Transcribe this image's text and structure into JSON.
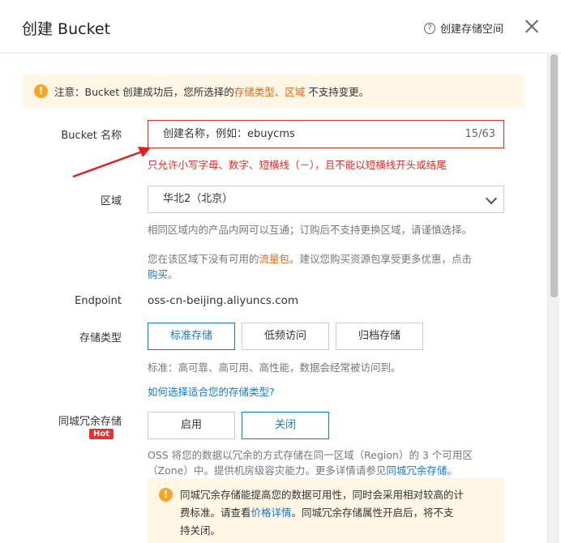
{
  "dialog": {
    "title": "创建 Bucket",
    "help_label": "创建存储空间",
    "help_icon": "?"
  },
  "notice": {
    "prefix": "注意：Bucket 创建成功后，您所选择的",
    "link1": "存储类型",
    "sep": "、",
    "link2": "区域",
    "suffix": "不支持变更。",
    "icon": "!"
  },
  "bucket_name": {
    "label": "Bucket 名称",
    "value": "创建名称，例如：ebuycms",
    "counter": "15/63",
    "error": "只允许小写字母、数字、短横线（－），且不能以短横线开头或结尾"
  },
  "region": {
    "label": "区域",
    "selected": "华北2（北京）",
    "hint1": "相同区域内的产品内网可以互通；订购后不支持更换区域，请谨慎选择。",
    "hint2_prefix": "您在该区域下没有可用的",
    "hint2_link": "流量包",
    "hint2_suffix": "。建议您购买资源包享受更多优惠，点击",
    "hint2_buy": "购买",
    "hint2_end": "。"
  },
  "endpoint": {
    "label": "Endpoint",
    "value": "oss-cn-beijing.aliyuncs.com"
  },
  "storage_class": {
    "label": "存储类型",
    "options": [
      "标准存储",
      "低频访问",
      "归档存储"
    ],
    "selected_index": 0,
    "hint": "标准：高可靠、高可用、高性能，数据会经常被访问到。",
    "link": "如何选择适合您的存储类型?"
  },
  "redundancy": {
    "label": "同城冗余存储",
    "hot_badge": "Hot",
    "options": [
      "启用",
      "关闭"
    ],
    "selected_index": 1,
    "desc_line1": "OSS 将您的数据以冗余的方式存储在同一区域（Region）的 3 个可用区",
    "desc_line2_prefix": "（Zone）中。提供机房级容灾能力。更多详情请参见",
    "desc_link": "同城冗余存储",
    "desc_end": "。",
    "tip_line1": "同城冗余存储能提高您的数据可用性，同时会采用相对较高的计",
    "tip_line2_prefix": "费标准。请查看",
    "tip_link": "价格详情",
    "tip_line2_suffix": "。同城冗余存储属性开启后，将不支",
    "tip_line3": "持关闭。"
  },
  "colors": {
    "accent": "#1478d4",
    "error": "#d93026",
    "warning": "#f5a623"
  }
}
